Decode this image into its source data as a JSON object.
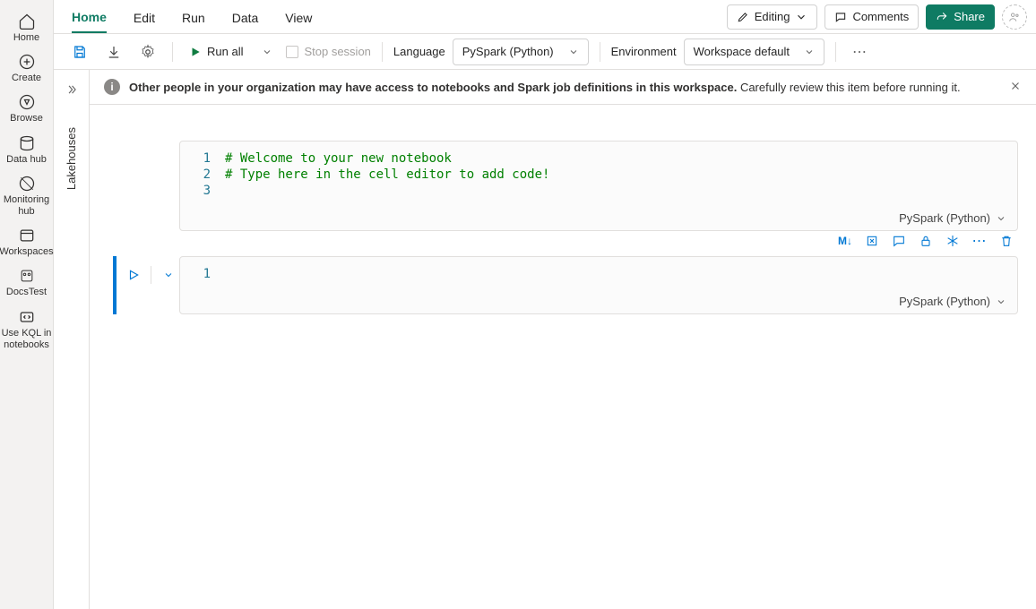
{
  "sidebar": {
    "items": [
      {
        "label": "Home"
      },
      {
        "label": "Create"
      },
      {
        "label": "Browse"
      },
      {
        "label": "Data hub"
      },
      {
        "label": "Monitoring hub"
      },
      {
        "label": "Workspaces"
      },
      {
        "label": "DocsTest"
      },
      {
        "label": "Use KQL in notebooks"
      }
    ]
  },
  "ribbon": {
    "tabs": [
      "Home",
      "Edit",
      "Run",
      "Data",
      "View"
    ],
    "active": "Home",
    "editing": "Editing",
    "comments": "Comments",
    "share": "Share"
  },
  "toolbar": {
    "run_all": "Run all",
    "stop_session": "Stop session",
    "language_label": "Language",
    "language_value": "PySpark (Python)",
    "env_label": "Environment",
    "env_value": "Workspace default"
  },
  "siderail": {
    "vertical_label": "Lakehouses"
  },
  "info_bar": {
    "bold": "Other people in your organization may have access to notebooks and Spark job definitions in this workspace.",
    "rest": "Carefully review this item before running it."
  },
  "cells": [
    {
      "lines": [
        {
          "n": "1",
          "text": "# Welcome to your new notebook",
          "cls": "comment"
        },
        {
          "n": "2",
          "text": "# Type here in the cell editor to add code!",
          "cls": "comment"
        },
        {
          "n": "3",
          "text": "",
          "cls": ""
        }
      ],
      "lang": "PySpark (Python)",
      "selected": false
    },
    {
      "lines": [
        {
          "n": "1",
          "text": "",
          "cls": ""
        }
      ],
      "lang": "PySpark (Python)",
      "selected": true
    }
  ],
  "cell_toolbar_md": "M↓"
}
